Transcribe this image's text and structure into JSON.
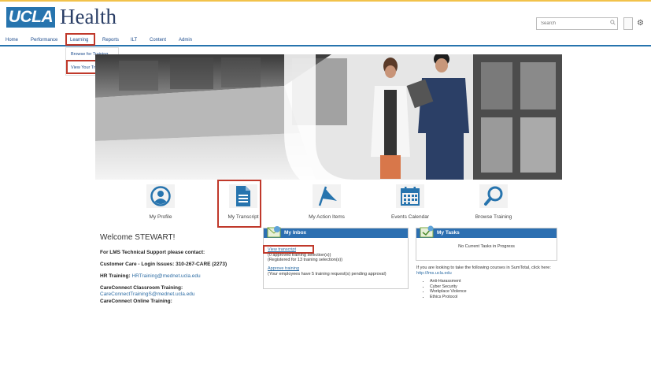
{
  "header": {
    "logo_ucla": "UCLA",
    "logo_health": "Health",
    "search_placeholder": "Search"
  },
  "nav": {
    "items": [
      "Home",
      "Performance",
      "Learning",
      "Reports",
      "ILT",
      "Content",
      "Admin"
    ]
  },
  "dropdown": {
    "items": [
      "Browse for Training",
      "View Your Transcript"
    ]
  },
  "tiles": [
    {
      "label": "My Profile",
      "icon": "user-profile-icon"
    },
    {
      "label": "My Transcript",
      "icon": "document-icon"
    },
    {
      "label": "My Action Items",
      "icon": "flag-icon"
    },
    {
      "label": "Events Calendar",
      "icon": "calendar-icon"
    },
    {
      "label": "Browse Training",
      "icon": "magnifier-icon"
    }
  ],
  "welcome": {
    "title": "Welcome STEWART!",
    "support": "For LMS Technical Support please contact:",
    "customer_care": "Customer Care - Login Issues: 310-267-CARE (2273)",
    "hr_label": "HR Training:",
    "hr_email": "HRTraining@mednet.ucla.edu",
    "cc_classroom": "CareConnect Classroom Training:",
    "cc_email": "CareConnectTrainingS@mednet.ucla.edu",
    "cc_online": "CareConnect Online Training:"
  },
  "inbox": {
    "title": "My Inbox",
    "view_transcript": "View transcript",
    "line1": "(0 approved training selection(s))",
    "line2": "(Registered for 13 training selection(s))",
    "approve_training": "Approve training",
    "line3": "(Your employees have 5 training request(s) pending approval)"
  },
  "tasks": {
    "title": "My Tasks",
    "empty": "No Current Tasks in Progress",
    "courses_intro": "If you are looking to take the following courses in SumTotal, click here:",
    "courses_link": "http://lms.ucla.edu",
    "courses": [
      "Anti-Harassment",
      "Cyber Security",
      "Workplace Violence",
      "Ethics Protocol"
    ]
  },
  "colors": {
    "brand_blue": "#2774ae",
    "panel_blue": "#2c6fb1",
    "highlight_red": "#c0392b",
    "gold_rule": "#f2c24b"
  }
}
